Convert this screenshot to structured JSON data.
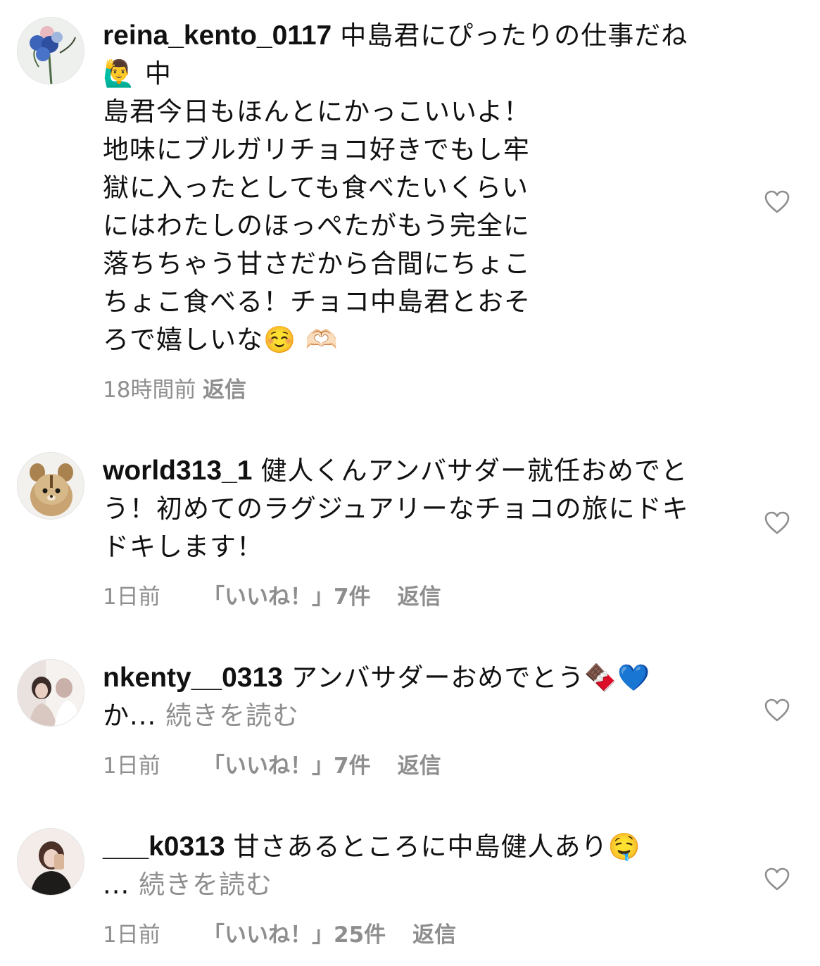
{
  "comments": [
    {
      "username": "reina_kento_0117",
      "text": "中島君にぴったりの仕事だね\n🙋‍♂️ 中\n島君今日もほんとにかっこいいよ！\n地味にブルガリチョコ好きでもし牢\n獄に入ったとしても食べたいくらい\nにはわたしのほっぺたがもう完全に\n落ちちゃう甘さだから合間にちょこ\nちょこ食べる！チョコ中島君とおそ\nろで嬉しいな☺️ 🫶🏻",
      "more_label": "",
      "time": "18時間前",
      "likes": "",
      "reply": "返信",
      "avatar_icon": "blue-rose-bouquet-avatar"
    },
    {
      "username": "world313_1",
      "text": "健人くんアンバサダー就任おめでと\nう！初めてのラグジュアリーなチョコの旅にドキ\nドキします！",
      "more_label": "",
      "time": "1日前",
      "likes": "「いいね！」7件",
      "reply": "返信",
      "avatar_icon": "squirrel-plush-avatar"
    },
    {
      "username": "nkenty__0313",
      "text": "アンバサダーおめでとう🍫💙\nか...",
      "more_label": "続きを読む",
      "time": "1日前",
      "likes": "「いいね！」7件",
      "reply": "返信",
      "avatar_icon": "person-photo-avatar"
    },
    {
      "username": "___k0313",
      "text": "甘さあるところに中島健人あり🤤\n...",
      "more_label": "続きを読む",
      "time": "1日前",
      "likes": "「いいね！」25件",
      "reply": "返信",
      "avatar_icon": "mirror-selfie-avatar"
    }
  ],
  "icons": {
    "like": "heart-outline-icon"
  },
  "colors": {
    "meta": "#8e8e8e",
    "text": "#111111"
  }
}
